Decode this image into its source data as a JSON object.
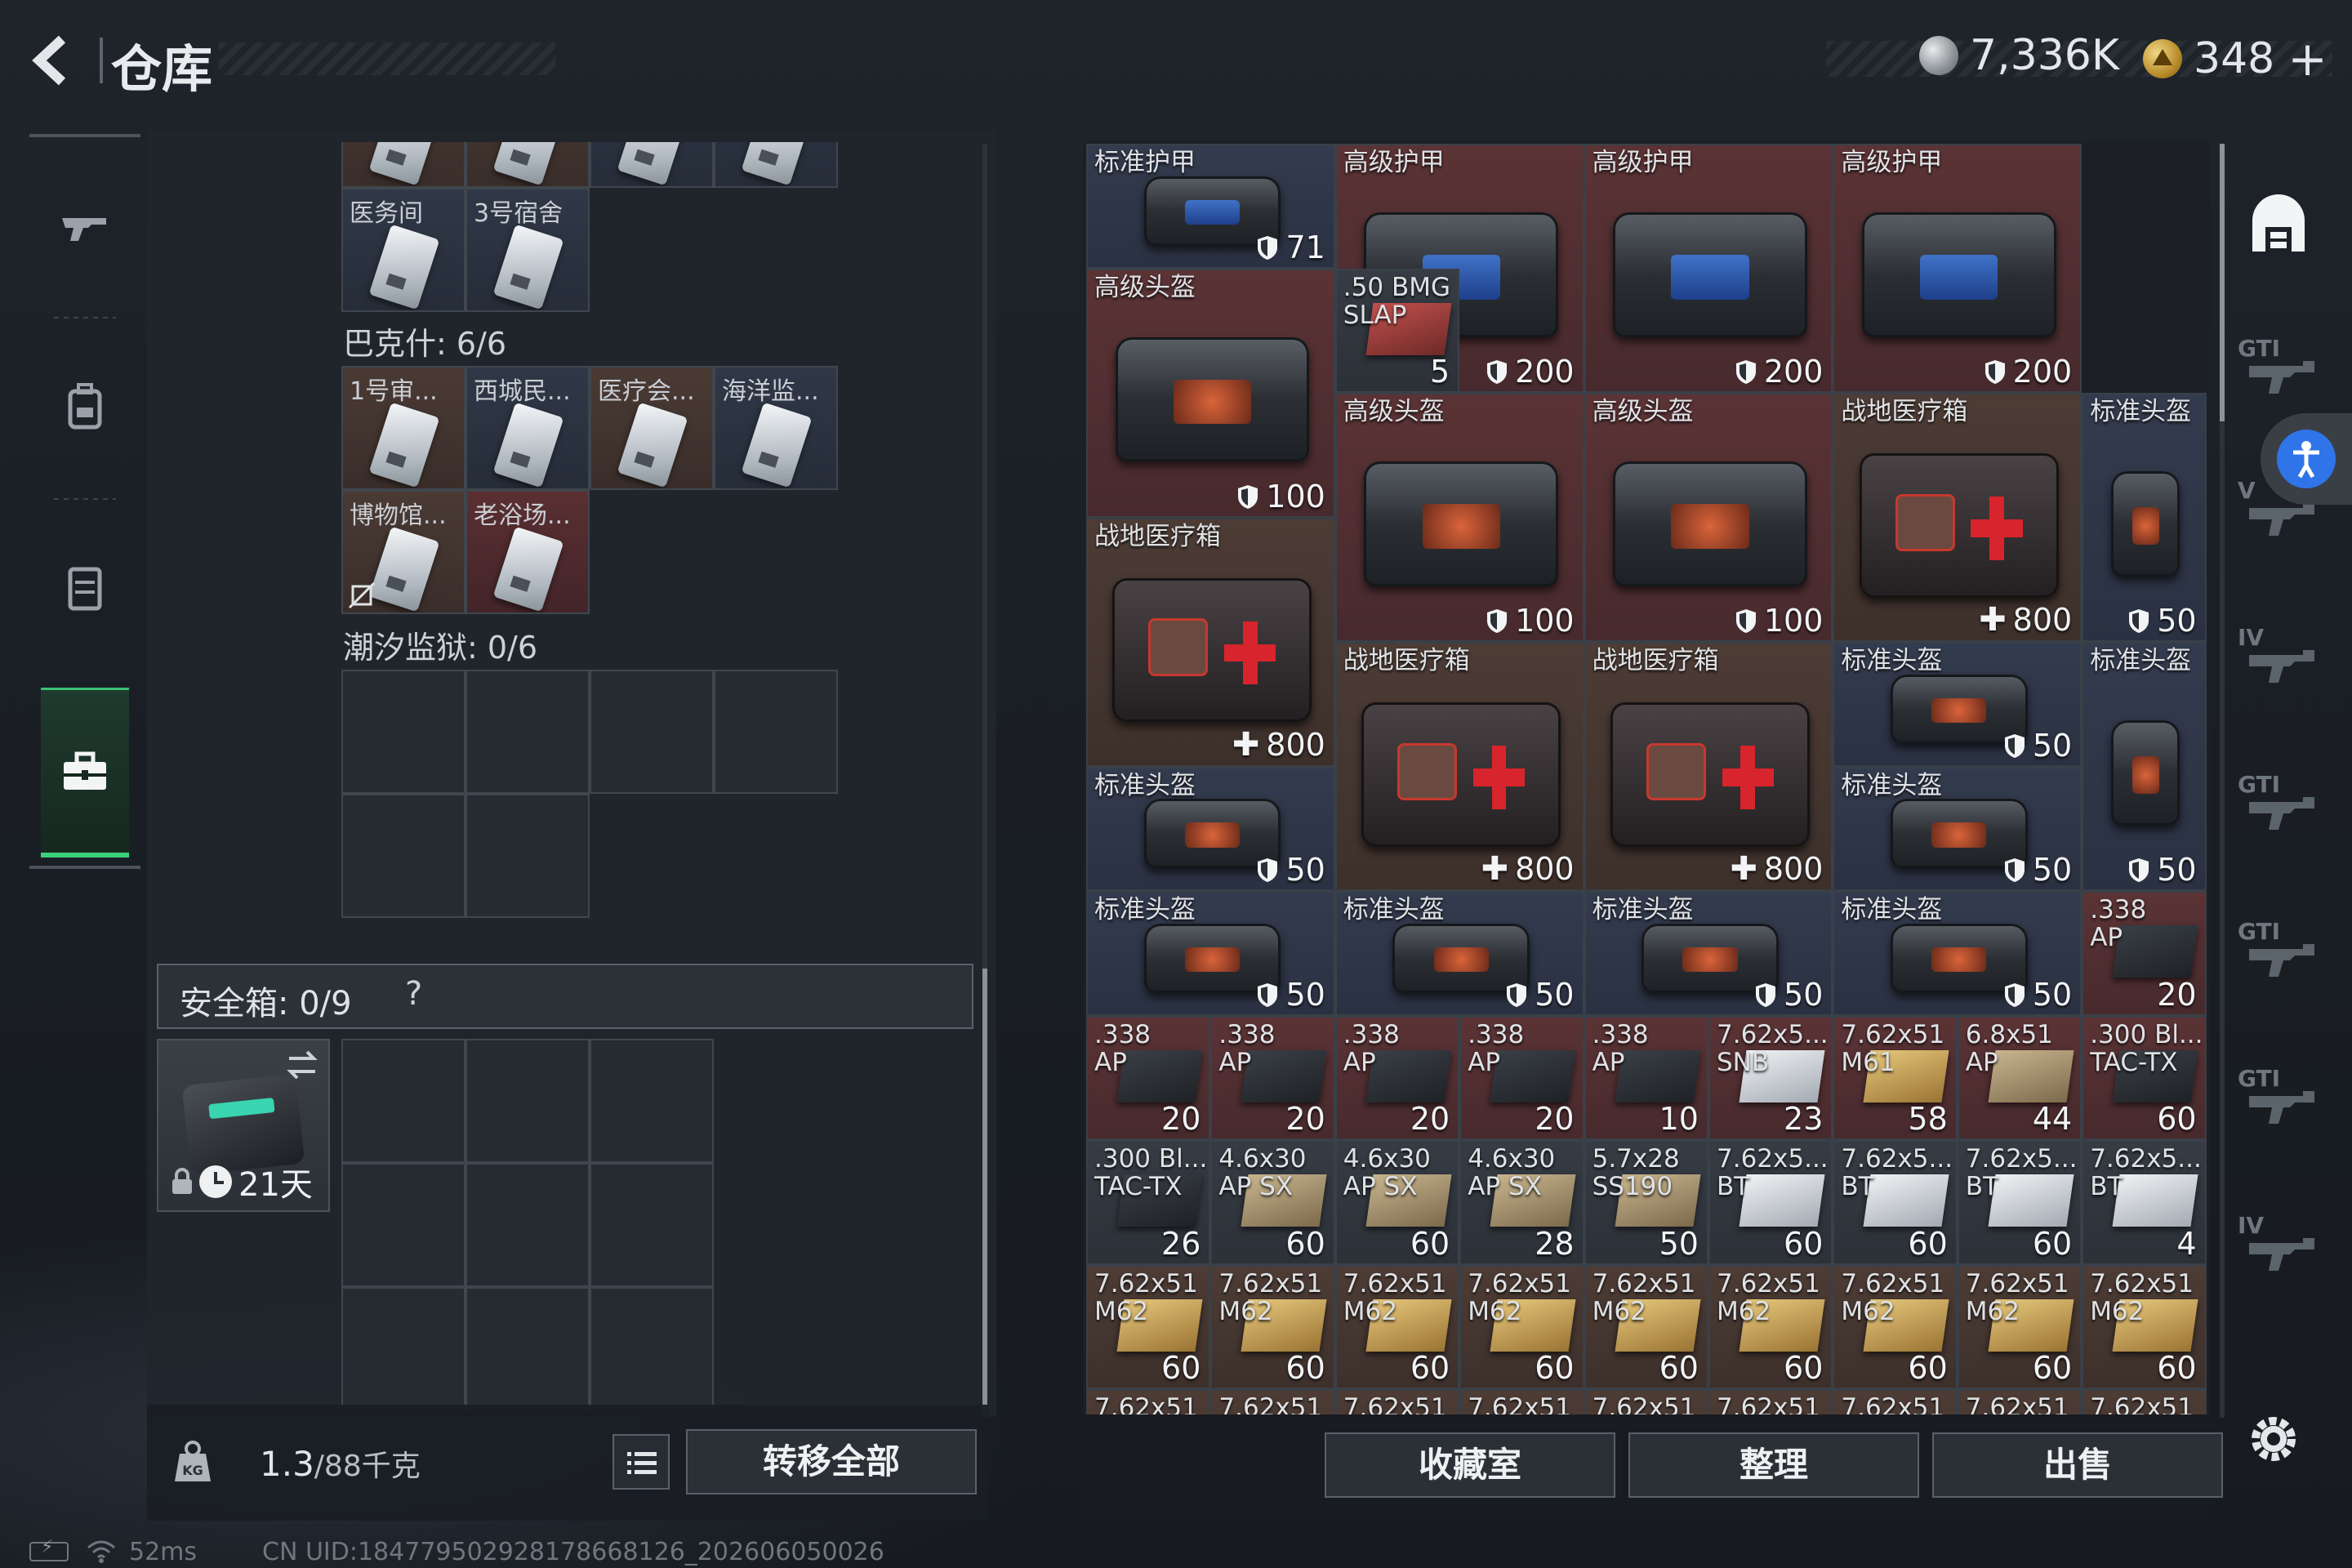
{
  "header": {
    "title": "仓库",
    "currency": [
      {
        "icon": "silver-coin-icon",
        "value": "7,336K"
      },
      {
        "icon": "gold-coin-icon",
        "value": "348"
      }
    ],
    "add_label": "+"
  },
  "left_rail": [
    {
      "icon": "gun-icon",
      "active": false
    },
    {
      "icon": "backpack-icon",
      "active": false
    },
    {
      "icon": "vest-icon",
      "active": false
    },
    {
      "icon": "toolbox-icon",
      "active": true
    }
  ],
  "left": {
    "top_row": [
      {
        "label": ""
      },
      {
        "label": ""
      },
      {
        "label": ""
      },
      {
        "label": ""
      }
    ],
    "keycards_a": [
      {
        "label": "医务间",
        "bg": "blue"
      },
      {
        "label": "3号宿舍",
        "bg": "blue"
      }
    ],
    "bakesh_label": "巴克什: 6/6",
    "keycards_b": [
      {
        "label": "1号审...",
        "bg": "brown"
      },
      {
        "label": "西城民...",
        "bg": "blue"
      },
      {
        "label": "医疗会...",
        "bg": "brown"
      },
      {
        "label": "海洋监...",
        "bg": "blue"
      },
      {
        "label": "博物馆...",
        "bg": "brown"
      },
      {
        "label": "老浴场...",
        "bg": "red"
      }
    ],
    "prison_label": "潮汐监狱: 0/6",
    "safe_label": "安全箱: 0/9",
    "safe_help": "?",
    "safe_timer": "21天",
    "weight_value": "1.3",
    "weight_max": "/88千克",
    "transfer_all": "转移全部"
  },
  "status_bar": {
    "ping": "52ms",
    "uid": "CN UID:1847795029281786681​26_202606050026"
  },
  "right": {
    "items": [
      {
        "label": "标准护甲",
        "count": "71",
        "badge": "shield",
        "type": "armor",
        "bg": "blue",
        "c": 0,
        "r": 0,
        "w": 2,
        "h": 1
      },
      {
        "label": "高级护甲",
        "count": "200",
        "badge": "shield",
        "type": "armor",
        "bg": "red",
        "c": 2,
        "r": 0,
        "w": 2,
        "h": 2
      },
      {
        "label": "高级护甲",
        "count": "200",
        "badge": "shield",
        "type": "armor",
        "bg": "red",
        "c": 4,
        "r": 0,
        "w": 2,
        "h": 2
      },
      {
        "label": "高级护甲",
        "count": "200",
        "badge": "shield",
        "type": "armor",
        "bg": "red",
        "c": 6,
        "r": 0,
        "w": 2,
        "h": 2
      },
      {
        "label": "高级头盔",
        "count": "100",
        "badge": "shield",
        "type": "helmet",
        "bg": "red",
        "c": 0,
        "r": 1,
        "w": 2,
        "h": 2
      },
      {
        "label": ".50 BMG\nSLAP",
        "count": "5",
        "badge": "",
        "type": "ammo-red",
        "bg": "gray",
        "c": 2,
        "r": 1,
        "w": 1,
        "h": 1
      },
      {
        "label": "高级头盔",
        "count": "100",
        "badge": "shield",
        "type": "helmet",
        "bg": "red",
        "c": 2,
        "r": 2,
        "w": 2,
        "h": 2
      },
      {
        "label": "高级头盔",
        "count": "100",
        "badge": "shield",
        "type": "helmet",
        "bg": "red",
        "c": 4,
        "r": 2,
        "w": 2,
        "h": 2
      },
      {
        "label": "战地医疗箱",
        "count": "800",
        "badge": "plus",
        "type": "medkit",
        "bg": "brown",
        "c": 6,
        "r": 2,
        "w": 2,
        "h": 2
      },
      {
        "label": "标准头盔",
        "count": "50",
        "badge": "shield",
        "type": "helmet-tall",
        "bg": "blue",
        "c": 8,
        "r": 2,
        "w": 1,
        "h": 2
      },
      {
        "label": "战地医疗箱",
        "count": "800",
        "badge": "plus",
        "type": "medkit",
        "bg": "brown",
        "c": 0,
        "r": 3,
        "w": 2,
        "h": 2
      },
      {
        "label": "战地医疗箱",
        "count": "800",
        "badge": "plus",
        "type": "medkit",
        "bg": "brown",
        "c": 2,
        "r": 4,
        "w": 2,
        "h": 2
      },
      {
        "label": "战地医疗箱",
        "count": "800",
        "badge": "plus",
        "type": "medkit",
        "bg": "brown",
        "c": 4,
        "r": 4,
        "w": 2,
        "h": 2
      },
      {
        "label": "标准头盔",
        "count": "50",
        "badge": "shield",
        "type": "helmet",
        "bg": "blue",
        "c": 6,
        "r": 4,
        "w": 2,
        "h": 1
      },
      {
        "label": "标准头盔",
        "count": "50",
        "badge": "shield",
        "type": "helmet-tall",
        "bg": "blue",
        "c": 8,
        "r": 4,
        "w": 1,
        "h": 2
      },
      {
        "label": "标准头盔",
        "count": "50",
        "badge": "shield",
        "type": "helmet",
        "bg": "blue",
        "c": 0,
        "r": 5,
        "w": 2,
        "h": 1
      },
      {
        "label": "标准头盔",
        "count": "50",
        "badge": "shield",
        "type": "helmet",
        "bg": "blue",
        "c": 6,
        "r": 5,
        "w": 2,
        "h": 1
      },
      {
        "label": "标准头盔",
        "count": "50",
        "badge": "shield",
        "type": "helmet",
        "bg": "blue",
        "c": 0,
        "r": 6,
        "w": 2,
        "h": 1
      },
      {
        "label": "标准头盔",
        "count": "50",
        "badge": "shield",
        "type": "helmet",
        "bg": "blue",
        "c": 2,
        "r": 6,
        "w": 2,
        "h": 1
      },
      {
        "label": "标准头盔",
        "count": "50",
        "badge": "shield",
        "type": "helmet",
        "bg": "blue",
        "c": 4,
        "r": 6,
        "w": 2,
        "h": 1
      },
      {
        "label": "标准头盔",
        "count": "50",
        "badge": "shield",
        "type": "helmet",
        "bg": "blue",
        "c": 6,
        "r": 6,
        "w": 2,
        "h": 1
      },
      {
        "label": ".338\nAP",
        "count": "20",
        "badge": "",
        "type": "ammo",
        "bg": "red",
        "c": 8,
        "r": 6,
        "w": 1,
        "h": 1
      },
      {
        "label": ".338\nAP",
        "count": "20",
        "badge": "",
        "type": "ammo",
        "bg": "red",
        "c": 0,
        "r": 7,
        "w": 1,
        "h": 1
      },
      {
        "label": ".338\nAP",
        "count": "20",
        "badge": "",
        "type": "ammo",
        "bg": "red",
        "c": 1,
        "r": 7,
        "w": 1,
        "h": 1
      },
      {
        "label": ".338\nAP",
        "count": "20",
        "badge": "",
        "type": "ammo",
        "bg": "red",
        "c": 2,
        "r": 7,
        "w": 1,
        "h": 1
      },
      {
        "label": ".338\nAP",
        "count": "20",
        "badge": "",
        "type": "ammo",
        "bg": "red",
        "c": 3,
        "r": 7,
        "w": 1,
        "h": 1
      },
      {
        "label": ".338\nAP",
        "count": "10",
        "badge": "",
        "type": "ammo",
        "bg": "red",
        "c": 4,
        "r": 7,
        "w": 1,
        "h": 1
      },
      {
        "label": "7.62x5...\nSNB",
        "count": "23",
        "badge": "",
        "type": "ammo-white",
        "bg": "red",
        "c": 5,
        "r": 7,
        "w": 1,
        "h": 1
      },
      {
        "label": "7.62x51\nM61",
        "count": "58",
        "badge": "",
        "type": "ammo-gold",
        "bg": "red",
        "c": 6,
        "r": 7,
        "w": 1,
        "h": 1
      },
      {
        "label": "6.8x51\nAP",
        "count": "44",
        "badge": "",
        "type": "ammo-tan",
        "bg": "red",
        "c": 7,
        "r": 7,
        "w": 1,
        "h": 1
      },
      {
        "label": ".300 Bl...\nTAC-TX",
        "count": "60",
        "badge": "",
        "type": "ammo",
        "bg": "red",
        "c": 8,
        "r": 7,
        "w": 1,
        "h": 1
      },
      {
        "label": ".300 Bl...\nTAC-TX",
        "count": "26",
        "badge": "",
        "type": "ammo",
        "bg": "gray",
        "c": 0,
        "r": 8,
        "w": 1,
        "h": 1
      },
      {
        "label": "4.6x30\nAP SX",
        "count": "60",
        "badge": "",
        "type": "ammo-tan",
        "bg": "gray",
        "c": 1,
        "r": 8,
        "w": 1,
        "h": 1
      },
      {
        "label": "4.6x30\nAP SX",
        "count": "60",
        "badge": "",
        "type": "ammo-tan",
        "bg": "gray",
        "c": 2,
        "r": 8,
        "w": 1,
        "h": 1
      },
      {
        "label": "4.6x30\nAP SX",
        "count": "28",
        "badge": "",
        "type": "ammo-tan",
        "bg": "gray",
        "c": 3,
        "r": 8,
        "w": 1,
        "h": 1
      },
      {
        "label": "5.7x28\nSS190",
        "count": "50",
        "badge": "",
        "type": "ammo-tan",
        "bg": "gray",
        "c": 4,
        "r": 8,
        "w": 1,
        "h": 1
      },
      {
        "label": "7.62x5...\nBT",
        "count": "60",
        "badge": "",
        "type": "ammo-white",
        "bg": "gray",
        "c": 5,
        "r": 8,
        "w": 1,
        "h": 1
      },
      {
        "label": "7.62x5...\nBT",
        "count": "60",
        "badge": "",
        "type": "ammo-white",
        "bg": "gray",
        "c": 6,
        "r": 8,
        "w": 1,
        "h": 1
      },
      {
        "label": "7.62x5...\nBT",
        "count": "60",
        "badge": "",
        "type": "ammo-white",
        "bg": "gray",
        "c": 7,
        "r": 8,
        "w": 1,
        "h": 1
      },
      {
        "label": "7.62x5...\nBT",
        "count": "4",
        "badge": "",
        "type": "ammo-white",
        "bg": "gray",
        "c": 8,
        "r": 8,
        "w": 1,
        "h": 1
      },
      {
        "label": "7.62x51\nM62",
        "count": "60",
        "badge": "",
        "type": "ammo-gold",
        "bg": "brown",
        "c": 0,
        "r": 9,
        "w": 1,
        "h": 1
      },
      {
        "label": "7.62x51\nM62",
        "count": "60",
        "badge": "",
        "type": "ammo-gold",
        "bg": "brown",
        "c": 1,
        "r": 9,
        "w": 1,
        "h": 1
      },
      {
        "label": "7.62x51\nM62",
        "count": "60",
        "badge": "",
        "type": "ammo-gold",
        "bg": "brown",
        "c": 2,
        "r": 9,
        "w": 1,
        "h": 1
      },
      {
        "label": "7.62x51\nM62",
        "count": "60",
        "badge": "",
        "type": "ammo-gold",
        "bg": "brown",
        "c": 3,
        "r": 9,
        "w": 1,
        "h": 1
      },
      {
        "label": "7.62x51\nM62",
        "count": "60",
        "badge": "",
        "type": "ammo-gold",
        "bg": "brown",
        "c": 4,
        "r": 9,
        "w": 1,
        "h": 1
      },
      {
        "label": "7.62x51\nM62",
        "count": "60",
        "badge": "",
        "type": "ammo-gold",
        "bg": "brown",
        "c": 5,
        "r": 9,
        "w": 1,
        "h": 1
      },
      {
        "label": "7.62x51\nM62",
        "count": "60",
        "badge": "",
        "type": "ammo-gold",
        "bg": "brown",
        "c": 6,
        "r": 9,
        "w": 1,
        "h": 1
      },
      {
        "label": "7.62x51\nM62",
        "count": "60",
        "badge": "",
        "type": "ammo-gold",
        "bg": "brown",
        "c": 7,
        "r": 9,
        "w": 1,
        "h": 1
      },
      {
        "label": "7.62x51\nM62",
        "count": "60",
        "badge": "",
        "type": "ammo-gold",
        "bg": "brown",
        "c": 8,
        "r": 9,
        "w": 1,
        "h": 1
      },
      {
        "label": "7.62x51",
        "count": "",
        "badge": "",
        "type": "none",
        "bg": "brown",
        "c": 0,
        "r": 10,
        "w": 1,
        "h": 1
      },
      {
        "label": "7.62x51",
        "count": "",
        "badge": "",
        "type": "none",
        "bg": "brown",
        "c": 1,
        "r": 10,
        "w": 1,
        "h": 1
      },
      {
        "label": "7.62x51",
        "count": "",
        "badge": "",
        "type": "none",
        "bg": "brown",
        "c": 2,
        "r": 10,
        "w": 1,
        "h": 1
      },
      {
        "label": "7.62x51",
        "count": "",
        "badge": "",
        "type": "none",
        "bg": "brown",
        "c": 3,
        "r": 10,
        "w": 1,
        "h": 1
      },
      {
        "label": "7.62x51",
        "count": "",
        "badge": "",
        "type": "none",
        "bg": "brown",
        "c": 4,
        "r": 10,
        "w": 1,
        "h": 1
      },
      {
        "label": "7.62x51",
        "count": "",
        "badge": "",
        "type": "none",
        "bg": "brown",
        "c": 5,
        "r": 10,
        "w": 1,
        "h": 1
      },
      {
        "label": "7.62x51",
        "count": "",
        "badge": "",
        "type": "none",
        "bg": "brown",
        "c": 6,
        "r": 10,
        "w": 1,
        "h": 1
      },
      {
        "label": "7.62x51",
        "count": "",
        "badge": "",
        "type": "none",
        "bg": "brown",
        "c": 7,
        "r": 10,
        "w": 1,
        "h": 1
      },
      {
        "label": "7.62x51",
        "count": "",
        "badge": "",
        "type": "none",
        "bg": "brown",
        "c": 8,
        "r": 10,
        "w": 1,
        "h": 1
      }
    ],
    "buttons": {
      "collection": "收藏室",
      "sort": "整理",
      "sell": "出售"
    }
  },
  "right_rail": {
    "weapon_tiers": [
      "GTI",
      "V",
      "IV",
      "GTI",
      "GTI",
      "GTI",
      "IV"
    ]
  },
  "colors": {
    "accent_green": "#3bd07c",
    "blue_cell": "#333b4e",
    "red_cell": "#5b3335",
    "brown_cell": "#4d3c35",
    "access_blue": "#2f74e8"
  }
}
